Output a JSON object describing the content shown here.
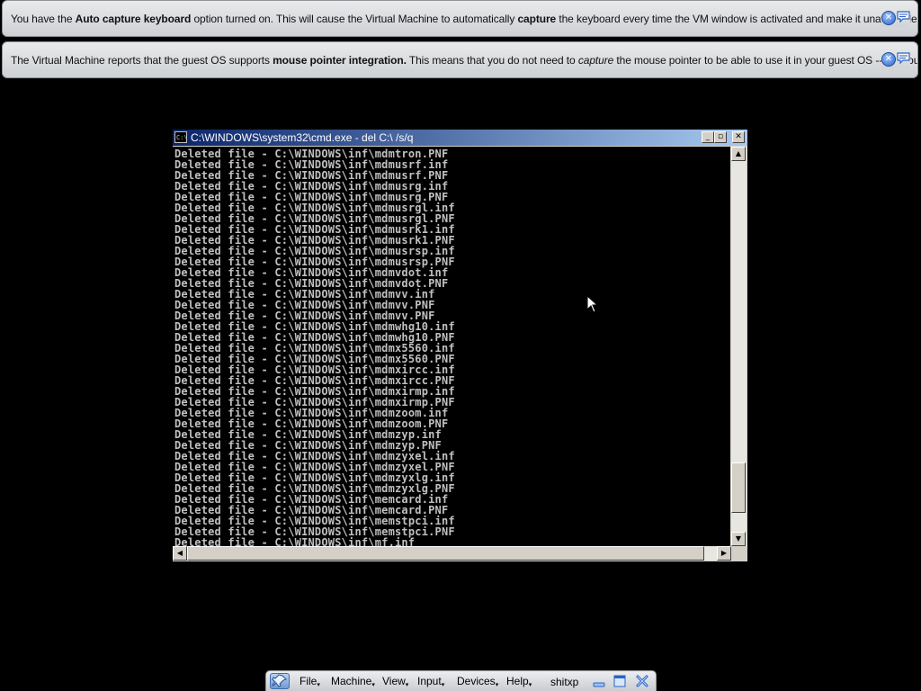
{
  "notifications": [
    {
      "segments": [
        {
          "text": "You have the ",
          "style": "normal"
        },
        {
          "text": "Auto capture keyboard",
          "style": "bold"
        },
        {
          "text": " option turned on. This will cause the Virtual Machine to automatically ",
          "style": "normal"
        },
        {
          "text": "capture",
          "style": "bold"
        },
        {
          "text": " the keyboard every time the VM window is activated and make it unavailable to",
          "style": "normal"
        }
      ],
      "close_icon": "close-icon",
      "do_not_show_icon": "message-icon"
    },
    {
      "segments": [
        {
          "text": "The Virtual Machine reports that the guest OS supports ",
          "style": "normal"
        },
        {
          "text": "mouse pointer integration.",
          "style": "bold"
        },
        {
          "text": " This means that you do not need to ",
          "style": "normal"
        },
        {
          "text": "capture",
          "style": "italic"
        },
        {
          "text": " the mouse pointer to be able to use it in your guest OS -- all mouse",
          "style": "normal"
        }
      ],
      "close_icon": "close-icon",
      "do_not_show_icon": "message-icon"
    }
  ],
  "console_window": {
    "title": "C:\\WINDOWS\\system32\\cmd.exe - del C:\\ /s/q",
    "icon_text": "C:\\",
    "buttons": {
      "minimize": "_",
      "maximize": "▫",
      "close": "✕"
    },
    "lines": [
      "Deleted file - C:\\WINDOWS\\inf\\mdmtron.PNF",
      "Deleted file - C:\\WINDOWS\\inf\\mdmusrf.inf",
      "Deleted file - C:\\WINDOWS\\inf\\mdmusrf.PNF",
      "Deleted file - C:\\WINDOWS\\inf\\mdmusrg.inf",
      "Deleted file - C:\\WINDOWS\\inf\\mdmusrg.PNF",
      "Deleted file - C:\\WINDOWS\\inf\\mdmusrgl.inf",
      "Deleted file - C:\\WINDOWS\\inf\\mdmusrgl.PNF",
      "Deleted file - C:\\WINDOWS\\inf\\mdmusrk1.inf",
      "Deleted file - C:\\WINDOWS\\inf\\mdmusrk1.PNF",
      "Deleted file - C:\\WINDOWS\\inf\\mdmusrsp.inf",
      "Deleted file - C:\\WINDOWS\\inf\\mdmusrsp.PNF",
      "Deleted file - C:\\WINDOWS\\inf\\mdmvdot.inf",
      "Deleted file - C:\\WINDOWS\\inf\\mdmvdot.PNF",
      "Deleted file - C:\\WINDOWS\\inf\\mdmvv.inf",
      "Deleted file - C:\\WINDOWS\\inf\\mdmvv.PNF",
      "Deleted file - C:\\WINDOWS\\inf\\mdmvv.PNF",
      "Deleted file - C:\\WINDOWS\\inf\\mdmwhg10.inf",
      "Deleted file - C:\\WINDOWS\\inf\\mdmwhg10.PNF",
      "Deleted file - C:\\WINDOWS\\inf\\mdmx5560.inf",
      "Deleted file - C:\\WINDOWS\\inf\\mdmx5560.PNF",
      "Deleted file - C:\\WINDOWS\\inf\\mdmxircc.inf",
      "Deleted file - C:\\WINDOWS\\inf\\mdmxircc.PNF",
      "Deleted file - C:\\WINDOWS\\inf\\mdmxirmp.inf",
      "Deleted file - C:\\WINDOWS\\inf\\mdmxirmp.PNF",
      "Deleted file - C:\\WINDOWS\\inf\\mdmzoom.inf",
      "Deleted file - C:\\WINDOWS\\inf\\mdmzoom.PNF",
      "Deleted file - C:\\WINDOWS\\inf\\mdmzyp.inf",
      "Deleted file - C:\\WINDOWS\\inf\\mdmzyp.PNF",
      "Deleted file - C:\\WINDOWS\\inf\\mdmzyxel.inf",
      "Deleted file - C:\\WINDOWS\\inf\\mdmzyxel.PNF",
      "Deleted file - C:\\WINDOWS\\inf\\mdmzyxlg.inf",
      "Deleted file - C:\\WINDOWS\\inf\\mdmzyxlg.PNF",
      "Deleted file - C:\\WINDOWS\\inf\\memcard.inf",
      "Deleted file - C:\\WINDOWS\\inf\\memcard.PNF",
      "Deleted file - C:\\WINDOWS\\inf\\memstpci.inf",
      "Deleted file - C:\\WINDOWS\\inf\\memstpci.PNF",
      "Deleted file - C:\\WINDOWS\\inf\\mf.inf"
    ],
    "vertical_scroll_position": 0.94,
    "scroll_arrows": {
      "up": "▲",
      "down": "▼",
      "left": "◀",
      "right": "▶"
    }
  },
  "mini_toolbar": {
    "menus": [
      "File",
      "Machine",
      "View",
      "Input",
      "Devices",
      "Help"
    ],
    "menu_arrow": "▾",
    "vm_name": "shitxp",
    "icons": [
      "pin-icon",
      "minimize-icon",
      "restore-icon",
      "close-icon"
    ]
  },
  "colors": {
    "desktop": "#000000",
    "notice_bg": "#dfe1e4",
    "titlebar_start": "#0a246a",
    "titlebar_end": "#a6caf0",
    "console_text": "#c0c0c0",
    "console_bg": "#000000",
    "accent_blue": "#2b63c4"
  }
}
